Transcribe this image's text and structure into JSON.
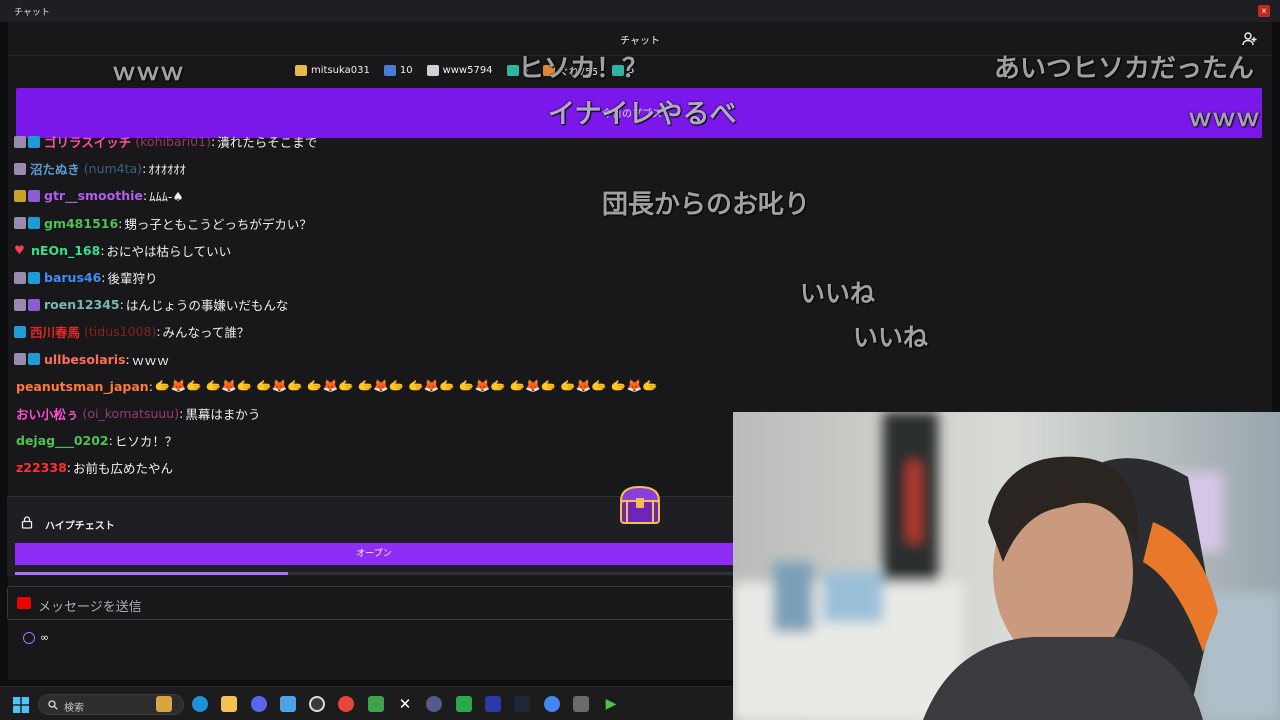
{
  "window": {
    "title": "チャット",
    "close_label": "x"
  },
  "chat": {
    "header_title": "チャット",
    "gifts": [
      {
        "name": "mitsuka031",
        "color": "#e8b84a"
      },
      {
        "name": "10",
        "color": "#4a7bd6"
      },
      {
        "name": "www5794",
        "color": "#cfcfd6"
      },
      {
        "name": "5",
        "color": "#2fb5a0"
      },
      {
        "name": "ぐれ755",
        "color": "#d88a3a"
      },
      {
        "name": "5",
        "color": "#2fb5a0"
      }
    ],
    "banner_label": "今日のプブス",
    "messages": [
      {
        "badges": [
          "sub",
          "prime"
        ],
        "user": "ゴリラスイッチ",
        "login": "(kohibari01)",
        "color": "#ff4fa3",
        "text": "潰れたらそこまで"
      },
      {
        "badges": [
          "sub"
        ],
        "user": "沼たぬき",
        "login": "(num4ta)",
        "color": "#5b9bd5",
        "text": "ｵｵｵｵｵｵ"
      },
      {
        "badges": [
          "gold",
          "purple"
        ],
        "user": "gtr__smoothie",
        "login": "",
        "color": "#b45cf0",
        "text": "ﾑﾑﾑ-♠"
      },
      {
        "badges": [
          "sub",
          "prime"
        ],
        "user": "gm481516",
        "login": "",
        "color": "#4fc152",
        "text": "甥っ子ともこうどっちがデカい？"
      },
      {
        "badges": [
          "heart"
        ],
        "user": "nEOn_168",
        "login": "",
        "color": "#37e08a",
        "text": "おにやは枯らしていい"
      },
      {
        "badges": [
          "sub",
          "prime"
        ],
        "user": "barus46",
        "login": "",
        "color": "#3f8cf5",
        "text": "後輩狩り"
      },
      {
        "badges": [
          "sub",
          "purple"
        ],
        "user": "roen12345",
        "login": "",
        "color": "#7ab6b6",
        "text": "はんじょうの事嫌いだもんな"
      },
      {
        "badges": [
          "prime"
        ],
        "user": "西川春馬",
        "login": "(tidus1008)",
        "color": "#e02828",
        "text": "みんなって誰？"
      },
      {
        "badges": [
          "sub",
          "prime"
        ],
        "user": "ullbesolaris",
        "login": "",
        "color": "#ff6e55",
        "text": "ｗｗｗ"
      },
      {
        "badges": [],
        "user": "peanutsman_japan",
        "login": "",
        "color": "#ff7a3c",
        "text": "🫱🦊🫱 🫱🦊🫱 🫱🦊🫱 🫱🦊🫱 🫱🦊🫱 🫱🦊🫱 🫱🦊🫱 🫱🦊🫱 🫱🦊🫱 🫱🦊🫱"
      },
      {
        "badges": [],
        "user": "おい小松ぅ",
        "login": "(oi_komatsuuu)",
        "color": "#ff4fd0",
        "text": "黒幕はまかう"
      },
      {
        "badges": [],
        "user": "dejag___0202",
        "login": "",
        "color": "#4fc152",
        "text": "ヒソカ！？"
      },
      {
        "badges": [],
        "user": "z22338",
        "login": "",
        "color": "#ff3030",
        "text": "お前も広めたやん"
      }
    ],
    "hype_chest": {
      "title": "ハイプチェスト",
      "button_label": "オープン",
      "progress": 0.38
    },
    "input": {
      "placeholder": "メッセージを送信"
    },
    "timer_text": "∞"
  },
  "overlay_comments": [
    {
      "text": "ｗｗｗ",
      "size": 24
    },
    {
      "text": "ヒソカ！？",
      "size": 26
    },
    {
      "text": "あいつヒソカだったん",
      "size": 26
    },
    {
      "text": "イナイレやるべ",
      "size": 27
    },
    {
      "text": "ｗｗｗ",
      "size": 24
    },
    {
      "text": "団長からのお叱り",
      "size": 26
    },
    {
      "text": "いいね",
      "size": 25
    },
    {
      "text": "いいね",
      "size": 25
    }
  ],
  "taskbar": {
    "search_placeholder": "検索"
  }
}
